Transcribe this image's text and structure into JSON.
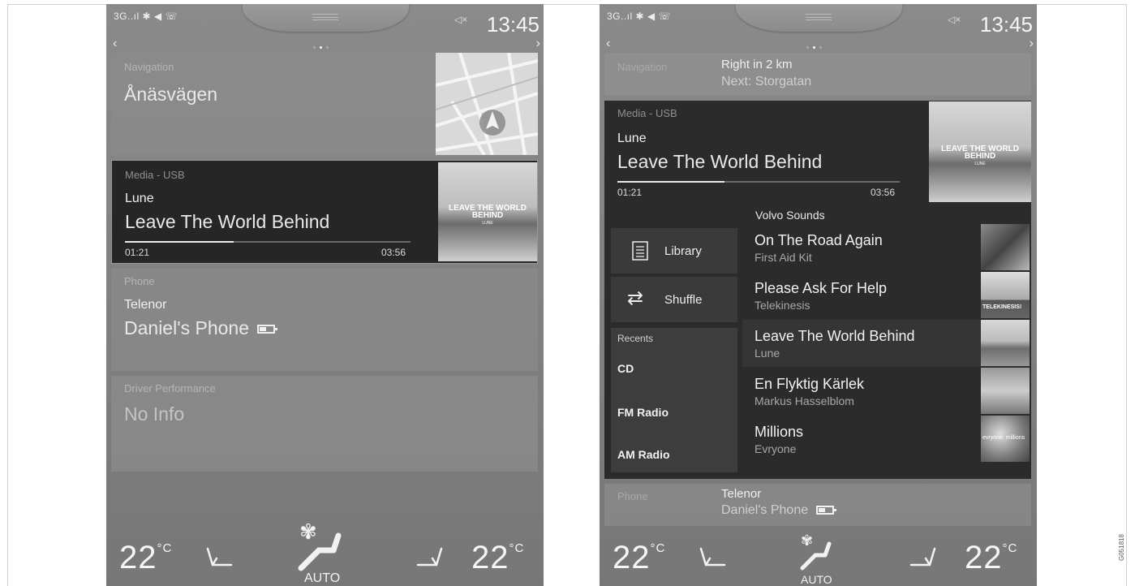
{
  "status": {
    "signal_left": "3G..ıl ✱ ◀ ☏",
    "signal_right": "3G..ıl ✱ ◀ ☏",
    "mute_icon": "speaker-muted-icon",
    "clock": "13:45"
  },
  "left": {
    "navigation": {
      "label": "Navigation",
      "street": "Ånäsvägen"
    },
    "media": {
      "label": "Media - USB",
      "artist": "Lune",
      "title": "Leave The World Behind",
      "elapsed": "01:21",
      "duration": "03:56",
      "progress": 0.38,
      "album_title": "LEAVE THE WORLD BEHIND",
      "album_sub": "LUNE"
    },
    "phone": {
      "label": "Phone",
      "carrier": "Telenor",
      "device": "Daniel's Phone"
    },
    "driver": {
      "label": "Driver Performance",
      "value": "No Info"
    }
  },
  "right": {
    "navigation": {
      "label": "Navigation",
      "instruction": "Right in 2 km",
      "next": "Next: Storgatan"
    },
    "media": {
      "label": "Media - USB",
      "artist": "Lune",
      "title": "Leave The World Behind",
      "elapsed": "01:21",
      "duration": "03:56",
      "progress": 0.38,
      "album_title": "LEAVE THE WORLD BEHIND",
      "album_sub": "LUNE"
    },
    "source_title": "Volvo Sounds",
    "library_label": "Library",
    "shuffle_label": "Shuffle",
    "recents": {
      "header": "Recents",
      "items": [
        "CD",
        "FM Radio",
        "AM Radio"
      ]
    },
    "tracks": [
      {
        "title": "On The Road Again",
        "artist": "First Aid Kit",
        "thumb": ""
      },
      {
        "title": "Please Ask For Help",
        "artist": "Telekinesis",
        "thumb": "TELEKINESIS!"
      },
      {
        "title": "Leave The World Behind",
        "artist": "Lune",
        "thumb": ""
      },
      {
        "title": "En Flyktig Kärlek",
        "artist": "Markus Hasselblom",
        "thumb": ""
      },
      {
        "title": "Millions",
        "artist": "Evryone",
        "thumb": "evryone. millions"
      }
    ],
    "phone": {
      "label": "Phone",
      "carrier": "Telenor",
      "device": "Daniel's Phone"
    }
  },
  "climate": {
    "left_temp": "22",
    "right_temp": "22",
    "unit": "°C",
    "mode": "AUTO"
  },
  "figure_code": "G051818",
  "colors": {
    "screen": "#808080",
    "media_bg": "#262626",
    "text": "#f2f2f2"
  }
}
